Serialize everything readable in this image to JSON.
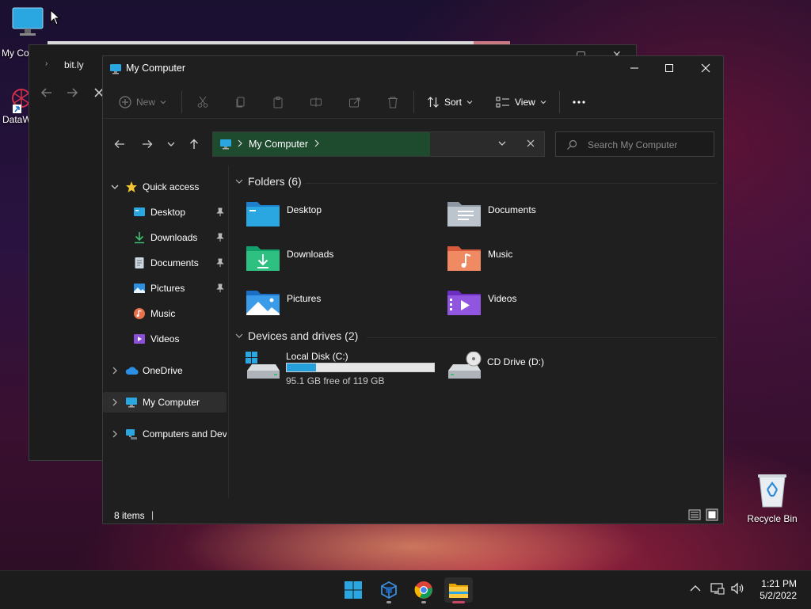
{
  "desktop": {
    "icons": [
      {
        "label": "My Co",
        "icon": "monitor-icon"
      },
      {
        "label": "DataW",
        "icon": "datawrapper-shortcut-icon"
      },
      {
        "label": "Recycle Bin",
        "icon": "recycle-bin-icon"
      }
    ]
  },
  "background_window": {
    "tab_label": "bit.ly"
  },
  "window": {
    "title": "My Computer",
    "toolbar": {
      "new_label": "New",
      "sort_label": "Sort",
      "view_label": "View",
      "more_label": "..."
    },
    "address": {
      "path_label": "My Computer"
    },
    "search": {
      "placeholder": "Search My Computer"
    },
    "sidebar": {
      "quick_access_label": "Quick access",
      "items": [
        {
          "label": "Desktop",
          "icon": "desktop-icon",
          "pinned": true
        },
        {
          "label": "Downloads",
          "icon": "downloads-icon",
          "pinned": true
        },
        {
          "label": "Documents",
          "icon": "documents-icon",
          "pinned": true
        },
        {
          "label": "Pictures",
          "icon": "pictures-icon",
          "pinned": true
        },
        {
          "label": "Music",
          "icon": "music-icon",
          "pinned": false
        },
        {
          "label": "Videos",
          "icon": "videos-icon",
          "pinned": false
        }
      ],
      "onedrive_label": "OneDrive",
      "mycomputer_label": "My Computer",
      "network_label": "Computers and Dev"
    },
    "folders_header": "Folders (6)",
    "folders": [
      {
        "label": "Desktop",
        "icon": "desktop-folder-icon"
      },
      {
        "label": "Documents",
        "icon": "documents-folder-icon"
      },
      {
        "label": "Downloads",
        "icon": "downloads-folder-icon"
      },
      {
        "label": "Music",
        "icon": "music-folder-icon"
      },
      {
        "label": "Pictures",
        "icon": "pictures-folder-icon"
      },
      {
        "label": "Videos",
        "icon": "videos-folder-icon"
      }
    ],
    "drives_header": "Devices and drives (2)",
    "drives": [
      {
        "label": "Local Disk (C:)",
        "free_text": "95.1 GB free of 119 GB",
        "used_fraction": 0.2
      },
      {
        "label": "CD Drive (D:)"
      }
    ],
    "status": {
      "items_text": "8 items"
    }
  },
  "taskbar": {
    "clock_time": "1:21 PM",
    "clock_date": "5/2/2022"
  },
  "colors": {
    "accent": "#26a0da",
    "address_green": "#1e4a2e",
    "window_bg": "#1f1f1f",
    "taskbar_bg": "#1c1c1c"
  }
}
